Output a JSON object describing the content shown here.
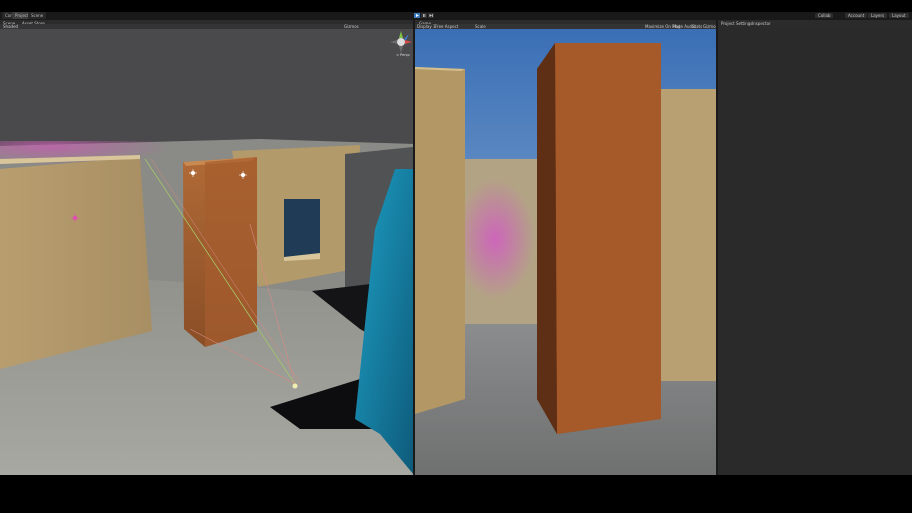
{
  "top_tabs": [
    {
      "label": "Console",
      "active": false
    },
    {
      "label": "Project",
      "active": true
    },
    {
      "label": "Scene",
      "active": false
    }
  ],
  "play_controls": [
    {
      "icon": "play-icon",
      "active": true
    },
    {
      "icon": "pause-icon",
      "active": false
    },
    {
      "icon": "step-icon",
      "active": false
    }
  ],
  "top_right": {
    "collab": "Collab",
    "account": "Account",
    "layers": "Layers",
    "layout": "Layout"
  },
  "scene_panel": {
    "tab_label": "Scene",
    "tab2_label": "Asset Store",
    "shading": "Shaded",
    "gizmos": "Gizmos",
    "view_label": "< Persp"
  },
  "game_panel": {
    "tab_label": "Game",
    "display": "Display 1",
    "aspect": "Free Aspect",
    "scale": "Scale",
    "maximize": "Maximize On Play",
    "mute": "Mute Audio",
    "stats": "Stats",
    "gizmos": "Gizmos"
  },
  "inspector_panel": {
    "tab1": "Project Settings",
    "tab2": "Inspector"
  },
  "colors": {
    "editor_bg": "#191919",
    "panel_header": "#2b2b2b",
    "accent_blue": "#3a79bb",
    "inspector_bg": "#2a2a2b"
  }
}
